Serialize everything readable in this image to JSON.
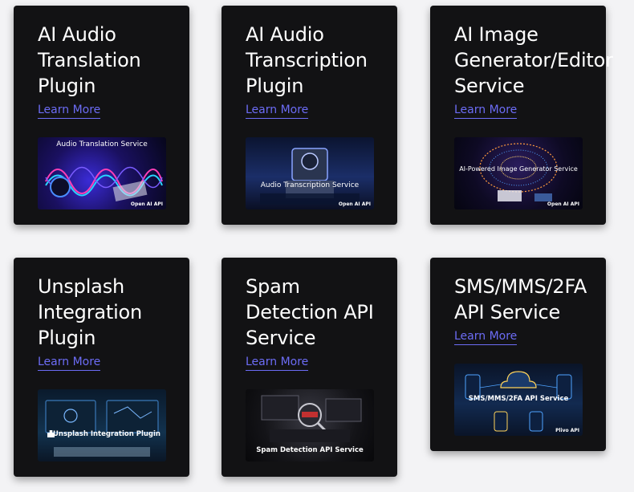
{
  "cards": [
    {
      "title": "AI Audio\nTranslation\nPlugin",
      "link": "Learn More",
      "image": {
        "caption": "Audio Translation Service",
        "tag": "Open AI API"
      }
    },
    {
      "title": "AI Audio\nTranscription\nPlugin",
      "link": "Learn More",
      "image": {
        "caption": "Audio Transcription Service",
        "tag": "Open AI API"
      }
    },
    {
      "title": "AI Image\nGenerator/Editor\nService",
      "link": "Learn More",
      "image": {
        "caption": "AI-Powered Image Generator Service",
        "tag": "Open AI API"
      }
    },
    {
      "title": "Unsplash\nIntegration\nPlugin",
      "link": "Learn More",
      "image": {
        "caption": "Unsplash Integration Plugin"
      }
    },
    {
      "title": "Spam\nDetection API\nService",
      "link": "Learn More",
      "image": {
        "caption": "Spam Detection API Service"
      }
    },
    {
      "title": "SMS/MMS/2FA\nAPI Service",
      "link": "Learn More",
      "image": {
        "caption": "SMS/MMS/2FA API Service",
        "tag": "Plivo API"
      }
    }
  ]
}
